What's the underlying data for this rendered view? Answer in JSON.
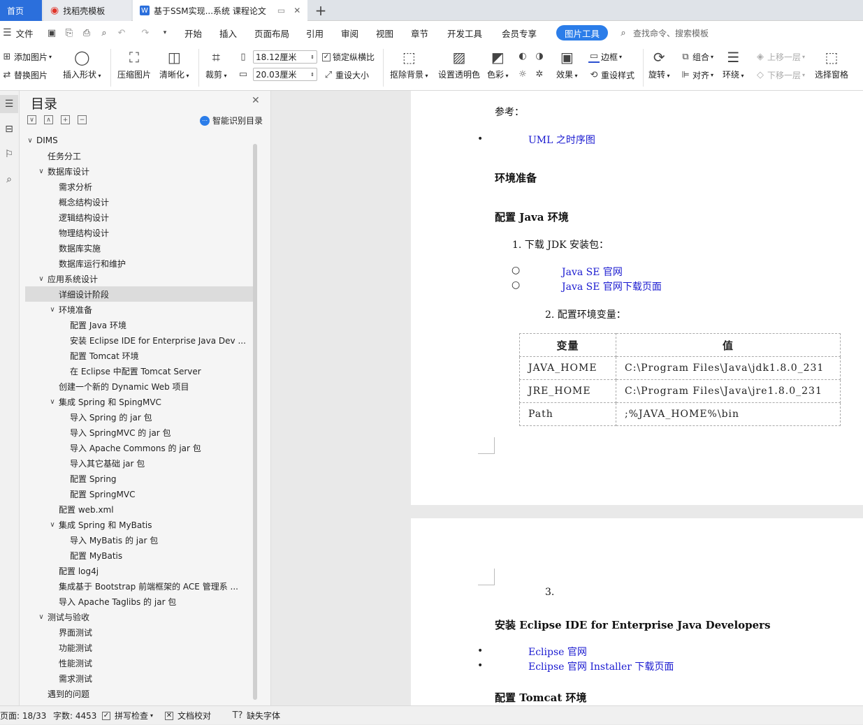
{
  "tabs": {
    "home": "首页",
    "template": "找稻壳模板",
    "doc": "基于SSM实现...系统 课程论文",
    "add": "+"
  },
  "menu": {
    "file": "文件",
    "items": [
      "开始",
      "插入",
      "页面布局",
      "引用",
      "审阅",
      "视图",
      "章节",
      "开发工具",
      "会员专享",
      "图片工具"
    ],
    "search": "查找命令、搜索模板"
  },
  "ribbon": {
    "add_image": "添加图片",
    "replace_image": "替换图片",
    "insert_shape": "插入形状",
    "compress": "压缩图片",
    "sharpen": "清晰化",
    "crop": "裁剪",
    "width": "18.12厘米",
    "height": "20.03厘米",
    "lock_ratio": "锁定纵横比",
    "reset_size": "重设大小",
    "remove_bg": "抠除背景",
    "set_transparent": "设置透明色",
    "color": "色彩",
    "effect": "效果",
    "border": "边框",
    "reset_style": "重设样式",
    "rotate": "旋转",
    "group": "组合",
    "align": "对齐",
    "wrap": "环绕",
    "bring_forward": "上移一层",
    "send_backward": "下移一层",
    "selection_pane": "选择窗格"
  },
  "toc": {
    "title": "目录",
    "smart": "智能识别目录",
    "items": [
      {
        "label": "DIMS",
        "level": 0,
        "expand": true
      },
      {
        "label": "任务分工",
        "level": 1,
        "expand": false
      },
      {
        "label": "数据库设计",
        "level": 1,
        "expand": true
      },
      {
        "label": "需求分析",
        "level": 2,
        "expand": false
      },
      {
        "label": "概念结构设计",
        "level": 2,
        "expand": false
      },
      {
        "label": "逻辑结构设计",
        "level": 2,
        "expand": false
      },
      {
        "label": "物理结构设计",
        "level": 2,
        "expand": false
      },
      {
        "label": "数据库实施",
        "level": 2,
        "expand": false
      },
      {
        "label": "数据库运行和维护",
        "level": 2,
        "expand": false
      },
      {
        "label": "应用系统设计",
        "level": 1,
        "expand": true
      },
      {
        "label": "详细设计阶段",
        "level": 2,
        "expand": false,
        "selected": true
      },
      {
        "label": "环境准备",
        "level": 2,
        "expand": true
      },
      {
        "label": "配置 Java 环境",
        "level": 3,
        "expand": false
      },
      {
        "label": "安装 Eclipse IDE for Enterprise Java Dev ...",
        "level": 3,
        "expand": false
      },
      {
        "label": "配置 Tomcat 环境",
        "level": 3,
        "expand": false
      },
      {
        "label": "在 Eclipse 中配置 Tomcat Server",
        "level": 3,
        "expand": false
      },
      {
        "label": "创建一个新的 Dynamic Web 项目",
        "level": 2,
        "expand": false
      },
      {
        "label": "集成 Spring 和 SpingMVC",
        "level": 2,
        "expand": true
      },
      {
        "label": "导入 Spring 的 jar 包",
        "level": 3,
        "expand": false
      },
      {
        "label": "导入 SpringMVC 的 jar 包",
        "level": 3,
        "expand": false
      },
      {
        "label": "导入 Apache Commons 的 jar 包",
        "level": 3,
        "expand": false
      },
      {
        "label": "导入其它基础 jar 包",
        "level": 3,
        "expand": false
      },
      {
        "label": "配置 Spring",
        "level": 3,
        "expand": false
      },
      {
        "label": "配置 SpringMVC",
        "level": 3,
        "expand": false
      },
      {
        "label": "配置 web.xml",
        "level": 2,
        "expand": false
      },
      {
        "label": "集成 Spring 和 MyBatis",
        "level": 2,
        "expand": true
      },
      {
        "label": "导入 MyBatis 的 jar 包",
        "level": 3,
        "expand": false
      },
      {
        "label": "配置 MyBatis",
        "level": 3,
        "expand": false
      },
      {
        "label": "配置 log4j",
        "level": 2,
        "expand": false
      },
      {
        "label": "集成基于 Bootstrap 前端框架的 ACE 管理系 ...",
        "level": 2,
        "expand": false
      },
      {
        "label": "导入 Apache Taglibs 的 jar 包",
        "level": 2,
        "expand": false
      },
      {
        "label": "测试与验收",
        "level": 1,
        "expand": true
      },
      {
        "label": "界面测试",
        "level": 2,
        "expand": false
      },
      {
        "label": "功能测试",
        "level": 2,
        "expand": false
      },
      {
        "label": "性能测试",
        "level": 2,
        "expand": false
      },
      {
        "label": "需求测试",
        "level": 2,
        "expand": false
      },
      {
        "label": "遇到的问题",
        "level": 1,
        "expand": false
      }
    ]
  },
  "doc": {
    "ref": "参考：",
    "uml_link": "UML 之时序图",
    "env_heading": "环境准备",
    "java_heading": "配置 Java 环境",
    "step1": "1.  下载 JDK 安装包：",
    "java_se_link": "Java SE 官网",
    "java_se_dl_link": "Java SE 官网下载页面",
    "step2": "2.  配置环境变量：",
    "table_header": [
      "变量",
      "值"
    ],
    "table_rows": [
      [
        "JAVA_HOME",
        "C:\\Program Files\\Java\\jdk1.8.0_231"
      ],
      [
        "JRE_HOME",
        "C:\\Program Files\\Java\\jre1.8.0_231"
      ],
      [
        "Path",
        ";%JAVA_HOME%\\bin"
      ]
    ],
    "step3": "3.",
    "eclipse_heading": "安装 Eclipse IDE for Enterprise Java Developers",
    "eclipse_link": "Eclipse 官网",
    "eclipse_installer_link": "Eclipse 官网 Installer 下载页面",
    "tomcat_heading": "配置 Tomcat 环境"
  },
  "status": {
    "page": "页面: 18/33",
    "words": "字数: 4453",
    "spell": "拼写检查",
    "proof": "文档校对",
    "missing_font": "缺失字体"
  }
}
